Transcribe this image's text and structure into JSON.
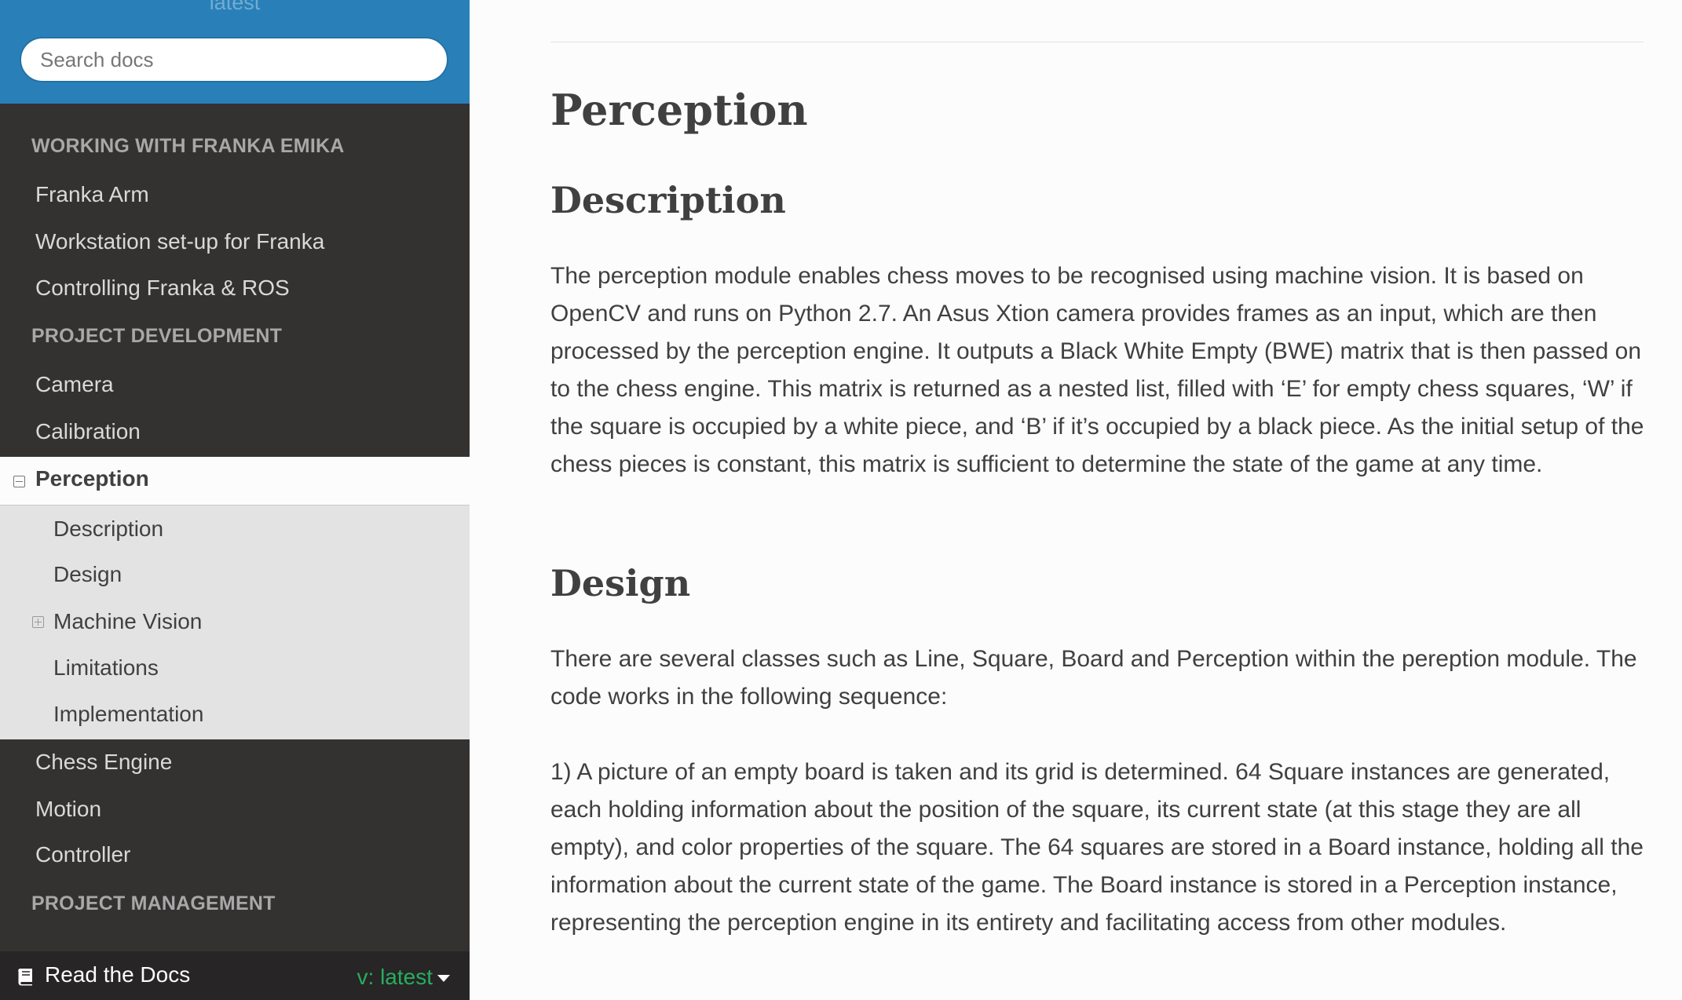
{
  "sidebar": {
    "version_top": "latest",
    "search": {
      "placeholder": "Search docs"
    },
    "captions": {
      "working": "WORKING WITH FRANKA EMIKA",
      "project_dev": "PROJECT DEVELOPMENT",
      "project_mgmt": "PROJECT MANAGEMENT"
    },
    "working_items": [
      "Franka Arm",
      "Workstation set-up for Franka",
      "Controlling Franka & ROS"
    ],
    "dev_items_before": [
      "Camera",
      "Calibration"
    ],
    "current": {
      "label": "Perception",
      "icon": "minus-square-icon",
      "children": [
        "Description",
        "Design",
        "Machine Vision",
        "Limitations",
        "Implementation"
      ],
      "expandable_child_icon": "plus-square-icon"
    },
    "dev_items_after": [
      "Chess Engine",
      "Motion",
      "Controller"
    ]
  },
  "rtd_bar": {
    "label": "Read the Docs",
    "version": "v: latest",
    "icon": "book-icon",
    "accent": "#27ae60"
  },
  "main": {
    "title": "Perception",
    "sections": [
      {
        "heading": "Description",
        "paragraphs": [
          "The perception module enables chess moves to be recognised using machine vision. It is based on OpenCV and runs on Python 2.7. An Asus Xtion camera provides frames as an input, which are then processed by the perception engine. It outputs a Black White Empty (BWE) matrix that is then passed on to the chess engine. This matrix is returned as a nested list, filled with ‘E’ for empty chess squares, ‘W’ if the square is occupied by a white piece, and ‘B’ if it’s occupied by a black piece. As the initial setup of the chess pieces is constant, this matrix is sufficient to determine the state of the game at any time."
        ]
      },
      {
        "heading": "Design",
        "paragraphs": [
          "There are several classes such as Line, Square, Board and Perception within the pereption module. The code works in the following sequence:",
          "1) A picture of an empty board is taken and its grid is determined. 64 Square instances are generated, each holding information about the position of the square, its current state (at this stage they are all empty), and color properties of the square. The 64 squares are stored in a Board instance, holding all the information about the current state of the game. The Board instance is stored in a Perception instance, representing the perception engine in its entirety and facilitating access from other modules."
        ]
      }
    ]
  },
  "colors": {
    "sidebar_bg": "#343131",
    "sidebar_top": "#2980b9",
    "text": "#404040"
  }
}
